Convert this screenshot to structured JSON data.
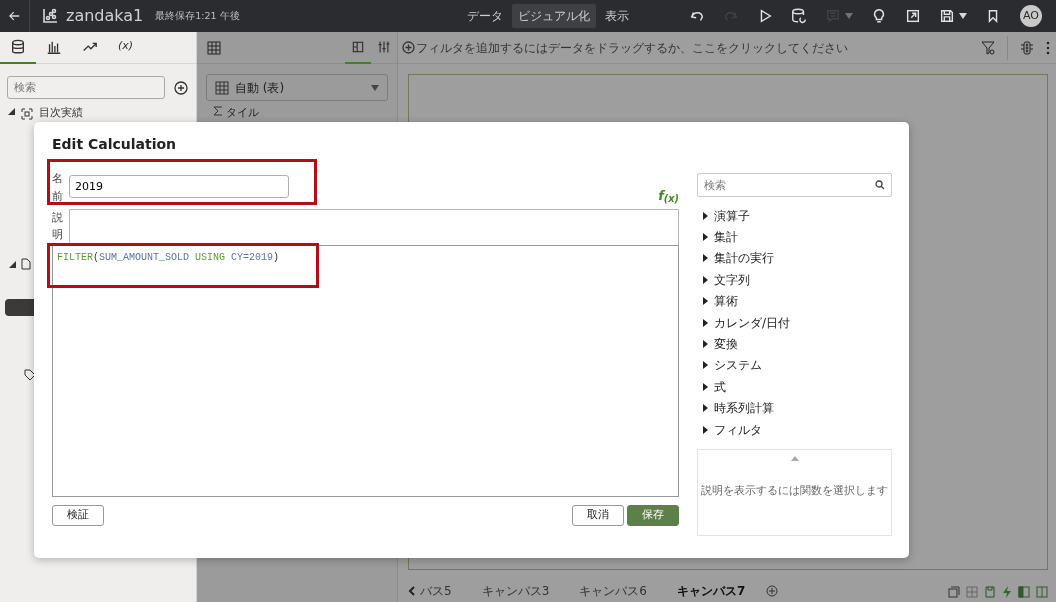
{
  "top_bar": {
    "title": "zandaka1",
    "saved": "最終保存1:21 午後",
    "user_initials": "AO",
    "modes": [
      {
        "label": "データ",
        "selected": false
      },
      {
        "label": "ビジュアル化",
        "selected": true
      },
      {
        "label": "表示",
        "selected": false
      }
    ],
    "tools": [
      {
        "kind": "undo",
        "disabled": false
      },
      {
        "kind": "redo",
        "disabled": true
      },
      {
        "kind": "play",
        "disabled": false
      },
      {
        "kind": "refresh",
        "disabled": false
      },
      {
        "kind": "comment",
        "disabled": true
      },
      {
        "kind": "bulb",
        "disabled": false
      },
      {
        "kind": "export",
        "disabled": false
      },
      {
        "kind": "save",
        "disabled": false
      },
      {
        "kind": "bookmark",
        "disabled": false
      }
    ]
  },
  "data_panel": {
    "tabs": [
      {
        "kind": "database",
        "selected": true
      },
      {
        "kind": "chart",
        "selected": false
      },
      {
        "kind": "trend",
        "selected": false
      },
      {
        "kind": "calc",
        "label": "(x)",
        "selected": false
      }
    ],
    "search": {
      "placeholder": "検索"
    },
    "tree_item": "目次実績"
  },
  "grammar_panel": {
    "tabs": [
      {
        "kind": "layout",
        "selected": true
      },
      {
        "kind": "properties",
        "selected": false
      }
    ],
    "viz_type": "自動 (表)",
    "section": "タイル"
  },
  "filter_bar": {
    "prompt": "フィルタを追加するにはデータをドラッグするか、ここをクリックしてください"
  },
  "canvas_tabs": [
    {
      "label": "バス5",
      "selected": false
    },
    {
      "label": "キャンバス3",
      "selected": false
    },
    {
      "label": "キャンバス6",
      "selected": false
    },
    {
      "label": "キャンバス7",
      "selected": true
    }
  ],
  "dialog": {
    "title": "Edit Calculation",
    "name_label": "名前",
    "name_value": "2019",
    "description_label": "説明",
    "function_button": "f$_{(x)}$",
    "expression": [
      {
        "kind": "keyword",
        "text": "FILTER"
      },
      {
        "kind": "punct",
        "text": "("
      },
      {
        "kind": "column",
        "text": "SUM_AMOUNT_SOLD"
      },
      {
        "kind": "keyword",
        "text": " USING "
      },
      {
        "kind": "column",
        "text": "CY=2019"
      },
      {
        "kind": "punct",
        "text": ")"
      }
    ],
    "name_highlighted": true,
    "expression_highlighted": true,
    "buttons": [
      {
        "label": "検証",
        "kind": "secondary"
      },
      {
        "label": "取消",
        "kind": "secondary"
      },
      {
        "label": "保存",
        "kind": "primary"
      }
    ],
    "function_search": {
      "placeholder": "検索"
    },
    "function_groups": [
      "演算子",
      "集計",
      "集計の実行",
      "文字列",
      "算術",
      "カレンダ/日付",
      "変換",
      "システム",
      "式",
      "時系列計算",
      "フィルタ"
    ],
    "help_text": "説明を表示するには関数を選択します"
  }
}
